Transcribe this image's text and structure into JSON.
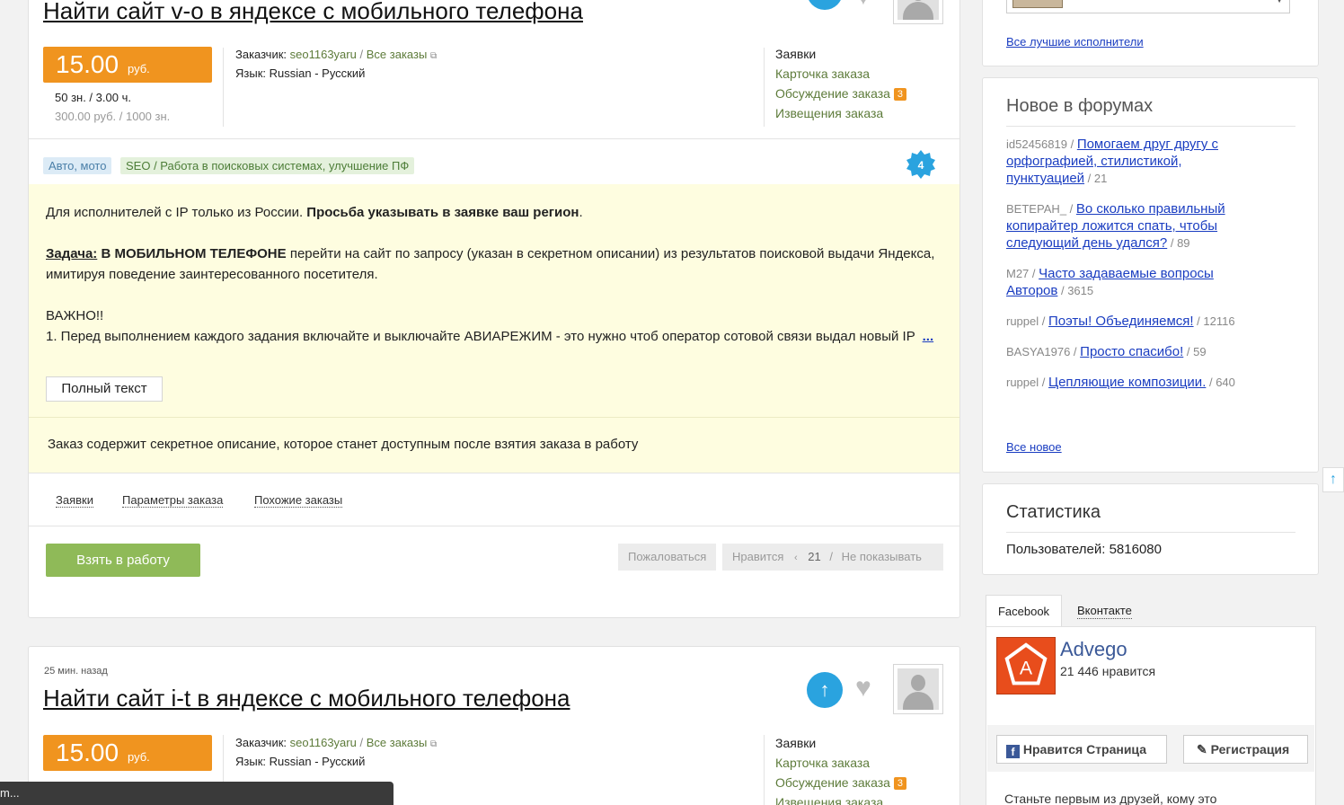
{
  "order1": {
    "title": "Найти сайт v-o в яндексе с мобильного телефона",
    "price": "15.00",
    "currency": "руб.",
    "volume": "50 зн.  /  3.00 ч.",
    "rate": "300.00 руб.  /  1000 зн.",
    "customer_label": "Заказчик:",
    "customer_name": "seo1163yaru",
    "all_orders": "Все заказы",
    "lang_label": "Язык:",
    "lang_value": "Russian - Русский",
    "links": [
      "Заявки",
      "Карточка заказа",
      "Обсуждение заказа",
      "Извещения заказа"
    ],
    "discussion_count": "3",
    "tags": [
      "Авто, мото",
      "SEO / Работа в поисковых системах, улучшение ПФ"
    ],
    "badge_count": "4",
    "desc_line1_normal": "Для исполнителей с IP только из России. ",
    "desc_line1_bold": "Просьба указывать в заявке ваш регион",
    "task_label": "Задача:",
    "task_bold": " В МОБИЛЬНОМ ТЕЛЕФОНЕ",
    "task_text": " перейти на сайт по запросу (указан в секретном описании) из результатов поисковой выдачи Яндекса, имитируя поведение заинтересованного посетителя.",
    "important": "ВАЖНО!!",
    "point1": "1. Перед выполнением каждого задания включайте и выключайте АВИАРЕЖИМ - это нужно чтоб оператор сотовой связи выдал новый IP",
    "more": "...",
    "full_text_btn": "Полный текст",
    "secret_note": "Заказ содержит секретное описание, которое станет доступным после взятия заказа в работу",
    "tabs": [
      "Заявки",
      "Параметры заказа",
      "Похожие заказы"
    ],
    "take_btn": "Взять в работу",
    "complain": "Пожаловаться",
    "like": "Нравится",
    "like_count": "21",
    "hide": "Не показывать"
  },
  "order2": {
    "time": "25 мин. назад",
    "title": "Найти сайт i-t в яндексе с мобильного телефона",
    "price": "15.00",
    "currency": "руб.",
    "customer_label": "Заказчик:",
    "customer_name": "seo1163yaru",
    "all_orders": "Все заказы",
    "lang_label": "Язык:",
    "lang_value": "Russian - Русский",
    "links": [
      "Заявки",
      "Карточка заказа",
      "Обсуждение заказа",
      "Извещения заказа"
    ],
    "discussion_count": "3"
  },
  "sidebar": {
    "best_performers": "Все лучшие исполнители",
    "forums_title": "Новое в форумах",
    "forum_items": [
      {
        "user": "id52456819",
        "topic": "Помогаем друг другу с орфографией, стилистикой, пунктуацией",
        "count": "21"
      },
      {
        "user": "ВЕТЕРАН_",
        "topic": "Во сколько правильный копирайтер ложится спать, чтобы следующий день удался?",
        "count": "89"
      },
      {
        "user": "M27",
        "topic": "Часто задаваемые вопросы Авторов",
        "count": "3615"
      },
      {
        "user": "ruppel",
        "topic": "Поэты! Объединяемся!",
        "count": "12116"
      },
      {
        "user": "BASYA1976",
        "topic": "Просто спасибо!",
        "count": "59"
      },
      {
        "user": "ruppel",
        "topic": "Цепляющие композиции.",
        "count": "640"
      }
    ],
    "all_new": "Все новое",
    "stats_title": "Статистика",
    "users_label": "Пользователей:",
    "users_count": "5816080",
    "social_tabs": [
      "Facebook",
      "Вконтакте"
    ],
    "fb_name": "Advego",
    "fb_likes": "21 446 нравится",
    "fb_like_page": "Нравится Страница",
    "fb_register": "Регистрация",
    "fb_friends": "Станьте первым из друзей, кому это"
  },
  "status_bar": "m...",
  "colors": {
    "accent": "#f0941f",
    "primary_btn": "#8fba58",
    "up_btn": "#2aa3df"
  }
}
